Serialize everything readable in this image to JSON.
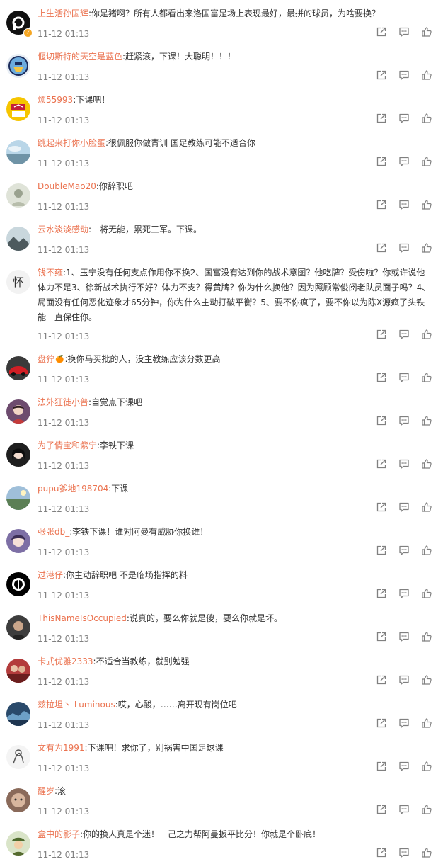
{
  "comments": [
    {
      "avatar_icon": "pen-logo-avatar",
      "username": "上生活孙国辉",
      "text": ":你是猪啊？所有人都看出来洛国富是场上表现最好，最拼的球员，为啥要换？",
      "time": "11-12 01:13",
      "verified": true
    },
    {
      "avatar_icon": "man-city-badge-avatar",
      "username": "偃切斯特的天空是蓝色",
      "text": ":赶紧滚，下课！大聪明！！！",
      "time": "11-12 01:13"
    },
    {
      "avatar_icon": "la-logo-avatar",
      "username": "烦55993",
      "text": ":下课吧！",
      "time": "11-12 01:13"
    },
    {
      "avatar_icon": "sky-landscape-avatar",
      "username": "跳起来打你小脸蛋",
      "text": ":很佩服你做青训 国足教练可能不适合你",
      "time": "11-12 01:13"
    },
    {
      "avatar_icon": "portrait-avatar",
      "username": "DoubleMao20",
      "text": ":你辞职吧",
      "time": "11-12 01:13"
    },
    {
      "avatar_icon": "mountain-avatar",
      "username": "云水淡淡感动",
      "text": ":一将无能，累死三军。下课。",
      "time": "11-12 01:13"
    },
    {
      "avatar_icon": "calligraphy-avatar",
      "username": "钱不雍",
      "text": ":1、玉宁没有任何支点作用你不换2、国富没有达到你的战术意图？他吃牌？受伤啦？你或许说他体力不足3、徐新战术执行不好？体力不支？得黄牌？你为什么换他？因为照顾常俊阅老队员面子吗？4、局面没有任何恶化迹象才65分钟，你为什么主动打破平衡？5、要不你疯了，要不你以为陈X源疯了头铁能一直保住你。",
      "time": "11-12 01:13",
      "tall": true
    },
    {
      "avatar_icon": "red-car-avatar",
      "username": "盘狞",
      "text": ":换你马买批的人，没主教练应该分数更高",
      "time": "11-12 01:13",
      "vip": true
    },
    {
      "avatar_icon": "girl-avatar",
      "username": "法外狂徒小普",
      "text": ":自觉点下课吧",
      "time": "11-12 01:13"
    },
    {
      "avatar_icon": "woman-portrait-avatar",
      "username": "为了倩宝和紫宁",
      "text": ":李铁下课",
      "time": "11-12 01:13"
    },
    {
      "avatar_icon": "landscape-avatar",
      "username": "pupu爹地198704",
      "text": ":下课",
      "time": "11-12 01:13"
    },
    {
      "avatar_icon": "anime-girl-avatar",
      "username": "张张db_",
      "text": ":李铁下课！谁对阿曼有威胁你换谁！",
      "time": "11-12 01:13"
    },
    {
      "avatar_icon": "black-white-avatar",
      "username": "过港仔",
      "text": ":你主动辞职吧 不是临场指挥的料",
      "time": "11-12 01:13"
    },
    {
      "avatar_icon": "man-portrait-avatar",
      "username": "ThisNameIsOccupied",
      "text": ":说真的，要么你就是傻，要么你就是坏。",
      "time": "11-12 01:13"
    },
    {
      "avatar_icon": "crowd-avatar",
      "username": "卡式优雅2333",
      "text": ":不适合当教练，就别勉强",
      "time": "11-12 01:13"
    },
    {
      "avatar_icon": "blue-scene-avatar",
      "username": "兹拉坦丶 Luminous",
      "text": ":哎，心酸，……离开现有岗位吧",
      "time": "11-12 01:13"
    },
    {
      "avatar_icon": "sketch-avatar",
      "username": "文有为1991",
      "text": ":下课吧！求你了，别祸害中国足球课",
      "time": "11-12 01:13"
    },
    {
      "avatar_icon": "face-avatar",
      "username": "醒岁",
      "text": ":滚",
      "time": "11-12 01:13"
    },
    {
      "avatar_icon": "soldier-avatar",
      "username": "盒中的影子",
      "text": ":你的换人真是个迷！一己之力帮阿曼扳平比分！你就是个卧底！",
      "time": "11-12 01:13"
    }
  ],
  "colors": {
    "username": "#eb7350",
    "time": "#808080",
    "text": "#333333",
    "icon": "#808080"
  },
  "action_icons": [
    "share-icon",
    "comment-icon",
    "like-icon"
  ]
}
